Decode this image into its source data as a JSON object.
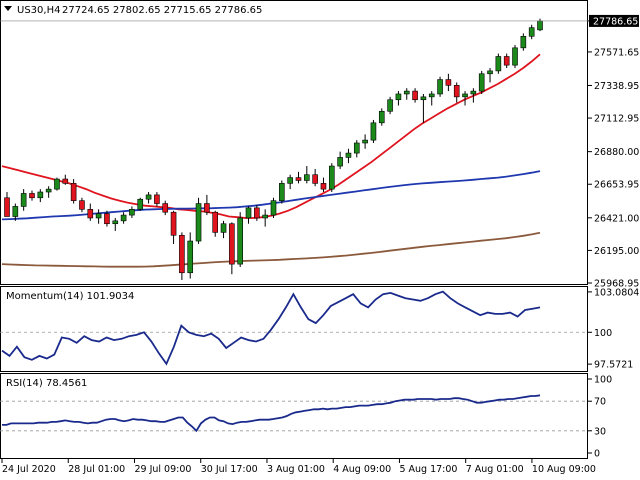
{
  "header": {
    "symbol_tf": "US30,H4",
    "ohlc": "27724.65 27802.65 27715.65 27786.65"
  },
  "colors": {
    "bull": "#1b8a1b",
    "bear": "#e0141e",
    "ma_fast": "#e0141e",
    "ma_mid": "#1f38b0",
    "ma_slow": "#8b5a3c",
    "indicator": "#1a2a8c",
    "grid": "#bbbbbb",
    "frame": "#000000"
  },
  "chart_data": [
    {
      "type": "candlestick",
      "title": "US30,H4",
      "price_labels": [
        "27786.65",
        "27571.65",
        "27338.95",
        "27112.95",
        "26880.00",
        "26653.95",
        "26421.00",
        "26195.00",
        "25968.95"
      ],
      "price_levels": [
        27786.65,
        27571.65,
        27338.95,
        27112.95,
        26880.0,
        26653.95,
        26421.0,
        26195.0,
        25968.95
      ],
      "current_price": "27786.65",
      "ylim": [
        25968.95,
        27800
      ],
      "x_labels": [
        "24 Jul 2020",
        "28 Jul 01:00",
        "29 Jul 09:00",
        "30 Jul 17:00",
        "3 Aug 01:00",
        "4 Aug 09:00",
        "5 Aug 17:00",
        "7 Aug 01:00",
        "10 Aug 09:00"
      ],
      "candles": [
        [
          26560,
          26600,
          26480,
          26430
        ],
        [
          26430,
          26520,
          26400,
          26500
        ],
        [
          26500,
          26620,
          26470,
          26590
        ],
        [
          26590,
          26610,
          26540,
          26560
        ],
        [
          26560,
          26620,
          26530,
          26600
        ],
        [
          26600,
          26640,
          26560,
          26620
        ],
        [
          26620,
          26700,
          26610,
          26690
        ],
        [
          26690,
          26720,
          26650,
          26660
        ],
        [
          26660,
          26690,
          26520,
          26540
        ],
        [
          26540,
          26560,
          26460,
          26480
        ],
        [
          26480,
          26520,
          26400,
          26420
        ],
        [
          26420,
          26480,
          26380,
          26450
        ],
        [
          26450,
          26470,
          26360,
          26380
        ],
        [
          26380,
          26420,
          26330,
          26400
        ],
        [
          26400,
          26460,
          26380,
          26440
        ],
        [
          26440,
          26500,
          26420,
          26480
        ],
        [
          26480,
          26560,
          26470,
          26550
        ],
        [
          26550,
          26600,
          26520,
          26580
        ],
        [
          26580,
          26600,
          26500,
          26520
        ],
        [
          26520,
          26540,
          26440,
          26460
        ],
        [
          26460,
          26470,
          26240,
          26300
        ],
        [
          26300,
          26320,
          25990,
          26040
        ],
        [
          26040,
          26320,
          26000,
          26260
        ],
        [
          26260,
          26560,
          26240,
          26520
        ],
        [
          26520,
          26580,
          26440,
          26460
        ],
        [
          26460,
          26470,
          26290,
          26320
        ],
        [
          26320,
          26400,
          26280,
          26380
        ],
        [
          26380,
          26390,
          26030,
          26100
        ],
        [
          26100,
          26460,
          26080,
          26420
        ],
        [
          26420,
          26500,
          26380,
          26490
        ],
        [
          26490,
          26510,
          26400,
          26420
        ],
        [
          26420,
          26480,
          26360,
          26440
        ],
        [
          26440,
          26560,
          26420,
          26540
        ],
        [
          26540,
          26680,
          26520,
          26660
        ],
        [
          26660,
          26720,
          26620,
          26700
        ],
        [
          26700,
          26740,
          26660,
          26680
        ],
        [
          26680,
          26780,
          26660,
          26720
        ],
        [
          26720,
          26760,
          26640,
          26660
        ],
        [
          26660,
          26700,
          26600,
          26620
        ],
        [
          26620,
          26800,
          26600,
          26780
        ],
        [
          26780,
          26880,
          26760,
          26840
        ],
        [
          26840,
          26900,
          26800,
          26870
        ],
        [
          26870,
          26960,
          26840,
          26940
        ],
        [
          26940,
          27000,
          26900,
          26960
        ],
        [
          26960,
          27100,
          26940,
          27080
        ],
        [
          27080,
          27180,
          27060,
          27160
        ],
        [
          27160,
          27260,
          27140,
          27240
        ],
        [
          27240,
          27300,
          27200,
          27280
        ],
        [
          27280,
          27320,
          27240,
          27300
        ],
        [
          27300,
          27320,
          27220,
          27240
        ],
        [
          27240,
          27280,
          27080,
          27260
        ],
        [
          27260,
          27300,
          27200,
          27280
        ],
        [
          27280,
          27400,
          27260,
          27380
        ],
        [
          27380,
          27420,
          27300,
          27340
        ],
        [
          27340,
          27360,
          27220,
          27260
        ],
        [
          27260,
          27300,
          27200,
          27280
        ],
        [
          27280,
          27320,
          27220,
          27300
        ],
        [
          27300,
          27440,
          27280,
          27420
        ],
        [
          27420,
          27460,
          27360,
          27440
        ],
        [
          27440,
          27560,
          27420,
          27540
        ],
        [
          27540,
          27560,
          27460,
          27480
        ],
        [
          27480,
          27620,
          27460,
          27600
        ],
        [
          27600,
          27700,
          27580,
          27680
        ],
        [
          27680,
          27760,
          27660,
          27740
        ],
        [
          27724.65,
          27802.65,
          27715.65,
          27786.65
        ]
      ],
      "series": [
        {
          "values": [
            26780,
            26765,
            26750,
            26735,
            26720,
            26705,
            26690,
            26675,
            26660,
            26640,
            26620,
            26595,
            26575,
            26555,
            26540,
            26525,
            26515,
            26505,
            26500,
            26495,
            26490,
            26480,
            26475,
            26470,
            26465,
            26455,
            26445,
            26430,
            26425,
            26420,
            26420,
            26425,
            26435,
            26450,
            26470,
            26495,
            26525,
            26555,
            26585,
            26615,
            26650,
            26690,
            26730,
            26770,
            26810,
            26855,
            26900,
            26945,
            26990,
            27035,
            27075,
            27110,
            27145,
            27180,
            27210,
            27240,
            27265,
            27290,
            27320,
            27350,
            27385,
            27420,
            27460,
            27505,
            27555
          ]
        },
        {
          "values": [
            26410,
            26412,
            26415,
            26418,
            26422,
            26426,
            26430,
            26433,
            26436,
            26440,
            26445,
            26450,
            26455,
            26460,
            26465,
            26470,
            26474,
            26478,
            26480,
            26482,
            26483,
            26484,
            26485,
            26486,
            26487,
            26488,
            26490,
            26492,
            26495,
            26500,
            26505,
            26512,
            26520,
            26528,
            26537,
            26546,
            26555,
            26563,
            26571,
            26579,
            26587,
            26595,
            26603,
            26611,
            26619,
            26627,
            26635,
            26642,
            26649,
            26655,
            26660,
            26664,
            26668,
            26672,
            26676,
            26680,
            26685,
            26690,
            26695,
            26700,
            26707,
            26715,
            26724,
            26734,
            26745
          ]
        },
        {
          "values": [
            26100,
            26097,
            26095,
            26093,
            26091,
            26090,
            26089,
            26088,
            26087,
            26086,
            26085,
            26084,
            26083,
            26082,
            26082,
            26082,
            26082,
            26083,
            26085,
            26088,
            26092,
            26096,
            26100,
            26104,
            26108,
            26112,
            26115,
            26118,
            26120,
            26122,
            26124,
            26126,
            26128,
            26130,
            26133,
            26136,
            26139,
            26142,
            26146,
            26150,
            26155,
            26160,
            26166,
            26172,
            26178,
            26185,
            26192,
            26199,
            26206,
            26213,
            26220,
            26226,
            26232,
            26238,
            26244,
            26250,
            26256,
            26262,
            26268,
            26274,
            26280,
            26288,
            26296,
            26306,
            26318
          ]
        }
      ]
    },
    {
      "type": "line",
      "title": "Momentum(14) 101.9034",
      "y_labels": [
        "103.0804",
        "100",
        "97.5721"
      ],
      "y_levels": [
        103.0804,
        100,
        97.5721
      ],
      "ylim": [
        97.2,
        103.3
      ],
      "dashed_level": 100,
      "values": [
        98.6,
        98.2,
        98.9,
        98.1,
        97.9,
        98.2,
        98.0,
        98.3,
        99.6,
        99.5,
        99.2,
        99.7,
        99.4,
        99.3,
        99.6,
        99.4,
        99.5,
        99.7,
        99.8,
        100.0,
        99.3,
        98.4,
        97.6,
        98.9,
        100.5,
        100.0,
        99.8,
        99.7,
        99.9,
        99.5,
        98.8,
        99.2,
        99.6,
        99.4,
        99.3,
        99.5,
        100.2,
        101.0,
        101.9,
        102.9,
        101.9,
        101.0,
        100.7,
        101.3,
        102.0,
        102.3,
        102.6,
        102.9,
        102.2,
        101.9,
        102.5,
        102.9,
        103.0,
        102.8,
        102.6,
        102.5,
        102.4,
        102.6,
        102.9,
        103.1,
        102.6,
        102.2,
        101.9,
        101.6,
        101.3,
        101.5,
        101.4,
        101.4,
        101.5,
        101.2,
        101.7,
        101.8,
        101.9
      ]
    },
    {
      "type": "line",
      "title": "RSI(14) 78.4561",
      "y_labels": [
        "100",
        "70",
        "30",
        "0"
      ],
      "y_levels": [
        100,
        70,
        30,
        0
      ],
      "ylim": [
        0,
        100
      ],
      "dashed_levels": [
        70,
        30
      ],
      "values": [
        38,
        38,
        40,
        40,
        40,
        40,
        40,
        40,
        41,
        41,
        41,
        42,
        42,
        43,
        44,
        43,
        42,
        42,
        41,
        40,
        41,
        41,
        43,
        45,
        46,
        46,
        44,
        43,
        44,
        46,
        45,
        45,
        44,
        43,
        43,
        42,
        42,
        44,
        46,
        48,
        48,
        41,
        36,
        30,
        40,
        45,
        48,
        48,
        44,
        43,
        40,
        39,
        41,
        42,
        42,
        43,
        44,
        45,
        45,
        45,
        46,
        47,
        48,
        50,
        53,
        55,
        56,
        57,
        58,
        59,
        59,
        60,
        59,
        60,
        60,
        61,
        62,
        62,
        63,
        64,
        64,
        64,
        65,
        66,
        66,
        67,
        68,
        70,
        71,
        72,
        72,
        72,
        73,
        73,
        73,
        73,
        72,
        73,
        73,
        73,
        74,
        74,
        73,
        72,
        70,
        68,
        68,
        69,
        70,
        71,
        72,
        72,
        73,
        73,
        74,
        75,
        76,
        77,
        77,
        78
      ]
    }
  ]
}
